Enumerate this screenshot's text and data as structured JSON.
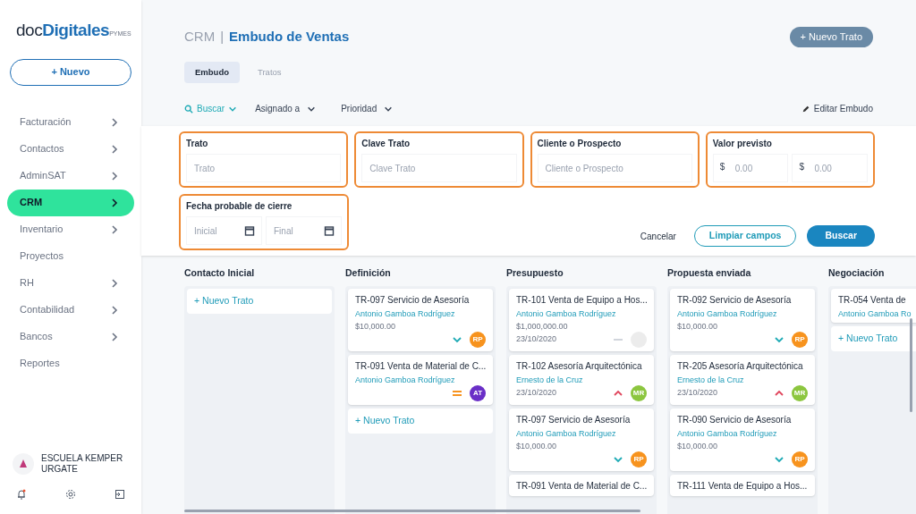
{
  "logo": {
    "light": "doc",
    "bold": "Digitales",
    "suffix": "PYMES"
  },
  "new_button": "+ Nuevo",
  "sidebar": {
    "items": [
      {
        "label": "Facturación",
        "selected": false,
        "has_submenu": true
      },
      {
        "label": "Contactos",
        "selected": false,
        "has_submenu": true
      },
      {
        "label": "AdminSAT",
        "selected": false,
        "has_submenu": true
      },
      {
        "label": "CRM",
        "selected": true,
        "has_submenu": true
      },
      {
        "label": "Inventario",
        "selected": false,
        "has_submenu": true
      },
      {
        "label": "Proyectos",
        "selected": false,
        "has_submenu": false
      },
      {
        "label": "RH",
        "selected": false,
        "has_submenu": true
      },
      {
        "label": "Contabilidad",
        "selected": false,
        "has_submenu": true
      },
      {
        "label": "Bancos",
        "selected": false,
        "has_submenu": true
      },
      {
        "label": "Reportes",
        "selected": false,
        "has_submenu": false
      }
    ],
    "account": "ESCUELA KEMPER URGATE"
  },
  "header": {
    "section": "CRM",
    "separator": "|",
    "title": "Embudo de Ventas",
    "action": "+ Nuevo Trato"
  },
  "tabs": [
    {
      "label": "Embudo",
      "selected": true
    },
    {
      "label": "Tratos",
      "selected": false
    }
  ],
  "filters": {
    "search": "Buscar",
    "dropdowns": [
      "Asignado a",
      "Prioridad"
    ],
    "edit": "Editar Embudo"
  },
  "search_form": {
    "fields": [
      {
        "kind": "text",
        "label": "Trato",
        "placeholders": [
          "Trato"
        ]
      },
      {
        "kind": "text",
        "label": "Clave Trato",
        "placeholders": [
          "Clave Trato"
        ]
      },
      {
        "kind": "text",
        "label": "Cliente o Prospecto",
        "placeholders": [
          "Cliente o Prospecto"
        ]
      },
      {
        "kind": "money",
        "label": "Valor previsto",
        "currency": "$",
        "placeholders": [
          "0.00",
          "0.00"
        ]
      },
      {
        "kind": "date",
        "label": "Fecha probable de cierre",
        "placeholders": [
          "Inicial",
          "Final"
        ]
      }
    ],
    "buttons": {
      "cancel": "Cancelar",
      "clear": "Limpiar campos",
      "search": "Buscar"
    }
  },
  "board": {
    "columns": [
      {
        "title": "Contacto Inicial",
        "add": "+ Nuevo Trato"
      },
      {
        "title": "Definición",
        "cards": [
          {
            "title": "TR-097 Servicio de Asesoría",
            "client": "Antonio Gamboa Rodríguez",
            "amount": "$10,000.00",
            "kind": "low",
            "assignee": "RP",
            "color": "#f7931e"
          },
          {
            "title": "TR-091 Venta de Material de C...",
            "client": "Antonio Gamboa Rodríguez",
            "kind": "medium",
            "assignee": "AT",
            "color": "#6a2fc7"
          }
        ],
        "add": "+ Nuevo Trato"
      },
      {
        "title": "Presupuesto",
        "cards": [
          {
            "title": "TR-101 Venta de Equipo a Hos...",
            "client": "Antonio Gamboa Rodríguez",
            "amount": "$1,000,000.00",
            "date": "23/10/2020",
            "kind": "none",
            "color": "#ececec"
          },
          {
            "title": "TR-102 Asesoría Arquitectónica",
            "client": "Ernesto de la Cruz",
            "date": "23/10/2020",
            "kind": "high",
            "assignee": "MR",
            "color": "#8cc63f"
          },
          {
            "title": "TR-097 Servicio de Asesoría",
            "client": "Antonio Gamboa Rodríguez",
            "amount": "$10,000.00",
            "kind": "low",
            "assignee": "RP",
            "color": "#f7931e"
          },
          {
            "title": "TR-091 Venta de Material de C..."
          }
        ]
      },
      {
        "title": "Propuesta enviada",
        "cards": [
          {
            "title": "TR-092 Servicio de Asesoría",
            "client": "Antonio Gamboa Rodríguez",
            "amount": "$10,000.00",
            "kind": "low",
            "assignee": "RP",
            "color": "#f7931e"
          },
          {
            "title": "TR-205 Asesoría Arquitectónica",
            "client": "Ernesto de la Cruz",
            "date": "23/10/2020",
            "kind": "high",
            "assignee": "MR",
            "color": "#8cc63f"
          },
          {
            "title": "TR-090 Servicio de Asesoría",
            "client": "Antonio Gamboa Rodríguez",
            "amount": "$10,000.00",
            "kind": "low",
            "assignee": "RP",
            "color": "#f7931e"
          },
          {
            "title": "TR-111 Venta de Equipo a Hos..."
          }
        ]
      },
      {
        "title": "Negociación",
        "cards": [
          {
            "title": "TR-054 Venta de",
            "client": "Antonio Gamboa Ro"
          }
        ],
        "add": "+ Nuevo Trato"
      }
    ]
  }
}
